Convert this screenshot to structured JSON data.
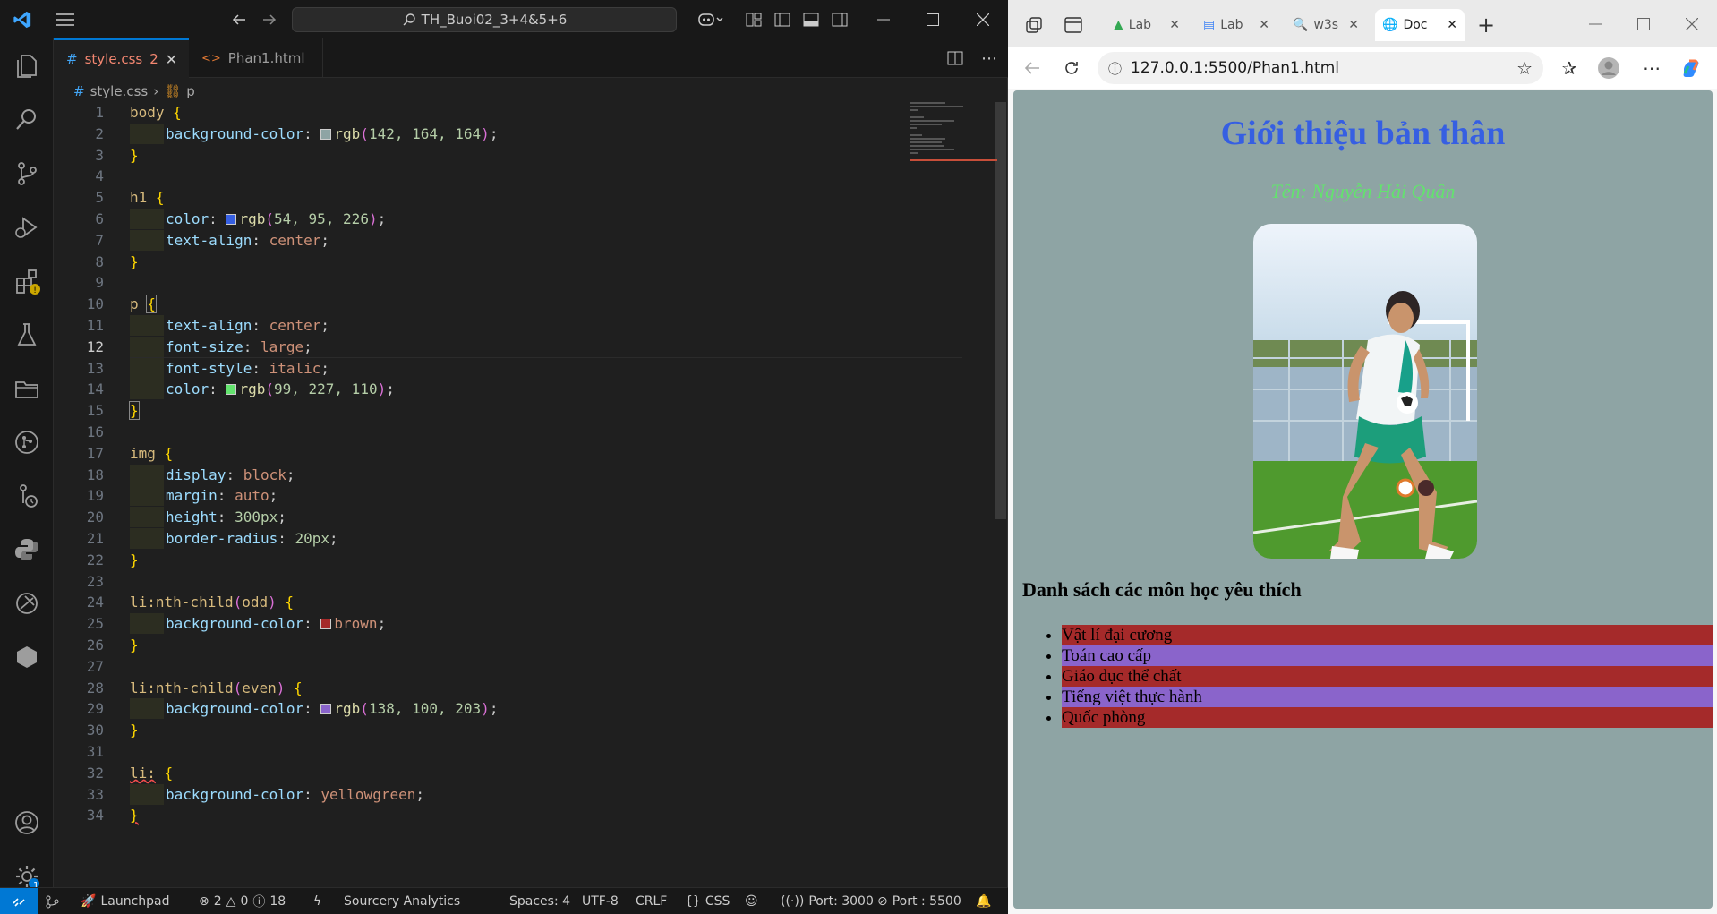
{
  "vscode": {
    "command_center": "TH_Buoi02_3+4&5+6",
    "tabs": [
      {
        "label": "style.css",
        "problems": "2"
      },
      {
        "label": "Phan1.html"
      }
    ],
    "breadcrumb": {
      "file": "style.css",
      "symbol": "p"
    },
    "line_numbers": [
      "1",
      "2",
      "3",
      "4",
      "5",
      "6",
      "7",
      "8",
      "9",
      "10",
      "11",
      "12",
      "13",
      "14",
      "15",
      "16",
      "17",
      "18",
      "19",
      "20",
      "21",
      "22",
      "23",
      "24",
      "25",
      "26",
      "27",
      "28",
      "29",
      "30",
      "31",
      "32",
      "33",
      "34"
    ],
    "current_line": "12",
    "code": {
      "body_sel": "body",
      "body_prop": "background-color",
      "body_fn": "rgb",
      "body_args": "142, 164, 164",
      "h1_sel": "h1",
      "h1_color_prop": "color",
      "h1_fn": "rgb",
      "h1_args": "54, 95, 226",
      "h1_align_prop": "text-align",
      "h1_align_val": "center",
      "p_sel": "p",
      "p_align_prop": "text-align",
      "p_align_val": "center",
      "p_size_prop": "font-size",
      "p_size_val": "large",
      "p_style_prop": "font-style",
      "p_style_val": "italic",
      "p_color_prop": "color",
      "p_fn": "rgb",
      "p_args": "99, 227, 110",
      "img_sel": "img",
      "img_display_prop": "display",
      "img_display_val": "block",
      "img_margin_prop": "margin",
      "img_margin_val": "auto",
      "img_height_prop": "height",
      "img_height_val": "300px",
      "img_radius_prop": "border-radius",
      "img_radius_val": "20px",
      "odd_sel": "li:nth-child",
      "odd_arg": "odd",
      "odd_prop": "background-color",
      "odd_val": "brown",
      "even_sel": "li:nth-child",
      "even_arg": "even",
      "even_prop": "background-color",
      "even_fn": "rgb",
      "even_args": "138, 100, 203",
      "li_sel": "li:",
      "li_prop": "background-color",
      "li_val": "yellowgreen"
    },
    "swatch_colors": {
      "body": "#8ea4a4",
      "h1": "#365fe2",
      "p": "#63e36e",
      "odd": "#a52a2a",
      "even": "#8a64cb"
    },
    "status": {
      "launchpad": "Launchpad",
      "errors": "2",
      "warnings": "0",
      "info": "18",
      "analytics": "Sourcery Analytics",
      "spaces": "Spaces: 4",
      "encoding": "UTF-8",
      "eol": "CRLF",
      "language": "CSS",
      "port1": "Port: 3000",
      "port2": "Port : 5500",
      "settings_badge": "1"
    }
  },
  "browser": {
    "tabs": [
      {
        "label": "Lab",
        "icon": "drive-icon"
      },
      {
        "label": "Lab",
        "icon": "docs-icon"
      },
      {
        "label": "w3s",
        "icon": "search-icon"
      },
      {
        "label": "Doc",
        "icon": "globe-icon"
      }
    ],
    "url": "127.0.0.1:5500/Phan1.html",
    "page": {
      "title": "Giới thiệu bản thân",
      "name_line": "Tên: Nguyễn Hải Quân",
      "list_heading": "Danh sách các môn học yêu thích",
      "subjects": [
        "Vật lí đại cương",
        "Toán cao cấp",
        "Giáo dục thể chất",
        "Tiếng việt thực hành",
        "Quốc phòng"
      ]
    }
  },
  "colors": {
    "accent": "#0078d4",
    "page_bg": "rgb(142,164,164)",
    "h1": "rgb(54,95,226)",
    "p": "rgb(99,227,110)",
    "odd_li": "brown",
    "even_li": "rgb(138,100,203)"
  }
}
